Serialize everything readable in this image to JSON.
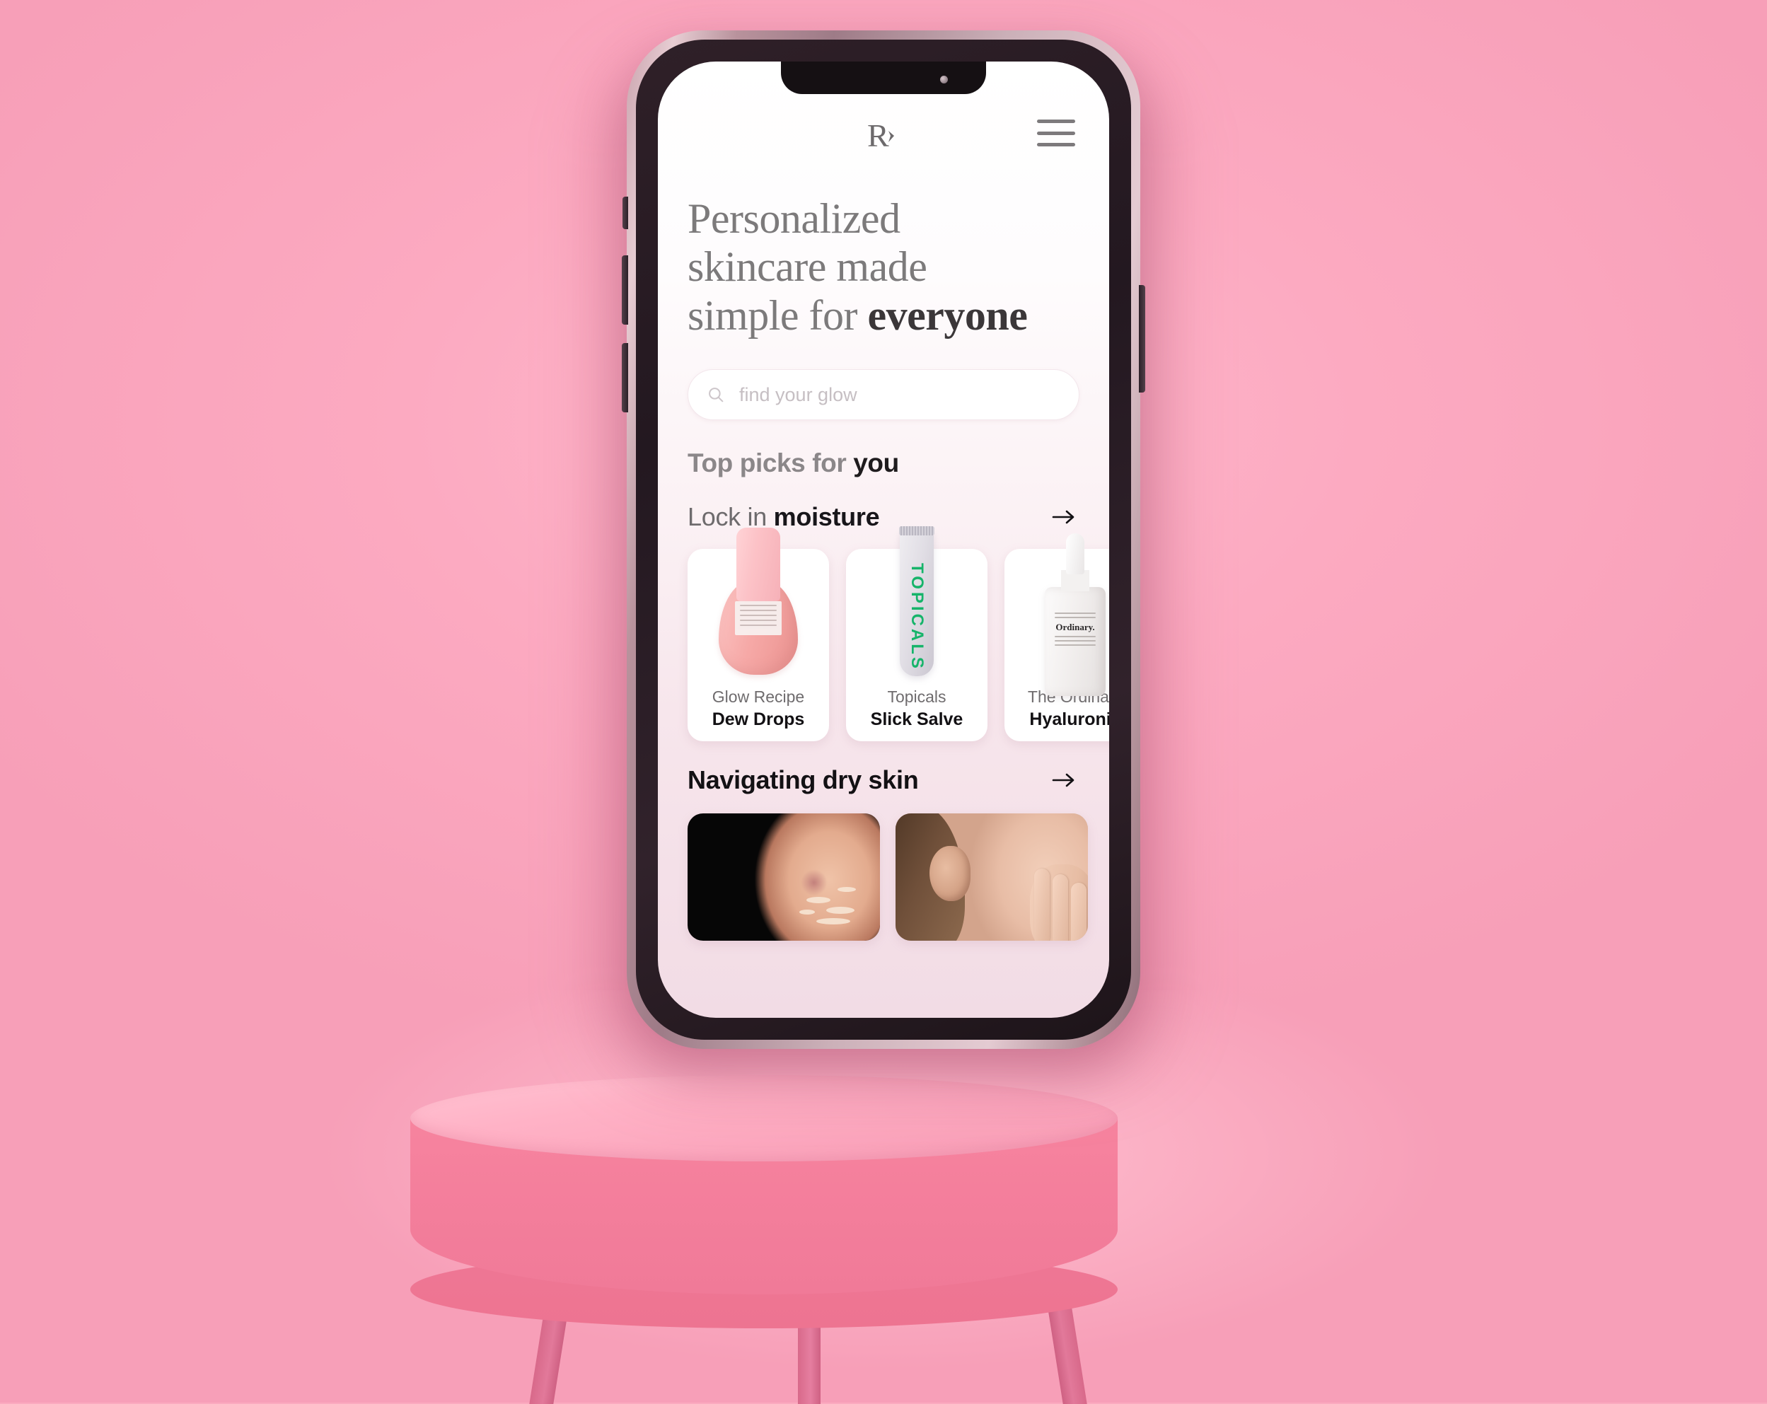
{
  "scene": {
    "background_color": "#fbaac0",
    "table_color": "#f47f9c",
    "phone_frame_color": "#c9a3ad"
  },
  "app": {
    "logo": "R",
    "menu_icon": "hamburger-menu-icon",
    "headline": {
      "line1": "Personalized",
      "line2": "skincare made",
      "line3_plain": "simple for ",
      "line3_bold": "everyone"
    },
    "search": {
      "icon": "search-icon",
      "placeholder": "find your glow",
      "value": ""
    },
    "sections": {
      "top_picks": {
        "label_plain": "Top picks for ",
        "label_bold": "you"
      },
      "lock_in_moisture": {
        "label_plain": "Lock in ",
        "label_bold": "moisture",
        "arrow_icon": "arrow-right-icon"
      },
      "navigating_dry_skin": {
        "label": "Navigating dry skin",
        "arrow_icon": "arrow-right-icon"
      }
    },
    "products": [
      {
        "brand": "Glow Recipe",
        "name": "Dew Drops",
        "image": "pink-dropper-bottle"
      },
      {
        "brand": "Topicals",
        "name": "Slick Salve",
        "image": "grey-squeeze-tube",
        "tube_text": "TOPICALS",
        "tube_text_color": "#16b46a"
      },
      {
        "brand": "The Ordinary",
        "name": "Hyaluronic",
        "image": "white-dropper-bottle",
        "label_brand": "Ordinary."
      }
    ],
    "articles": [
      {
        "image": "face-with-flaking-dry-skin-on-dark-background"
      },
      {
        "image": "woman-touching-cheek-dry-skin"
      }
    ]
  }
}
